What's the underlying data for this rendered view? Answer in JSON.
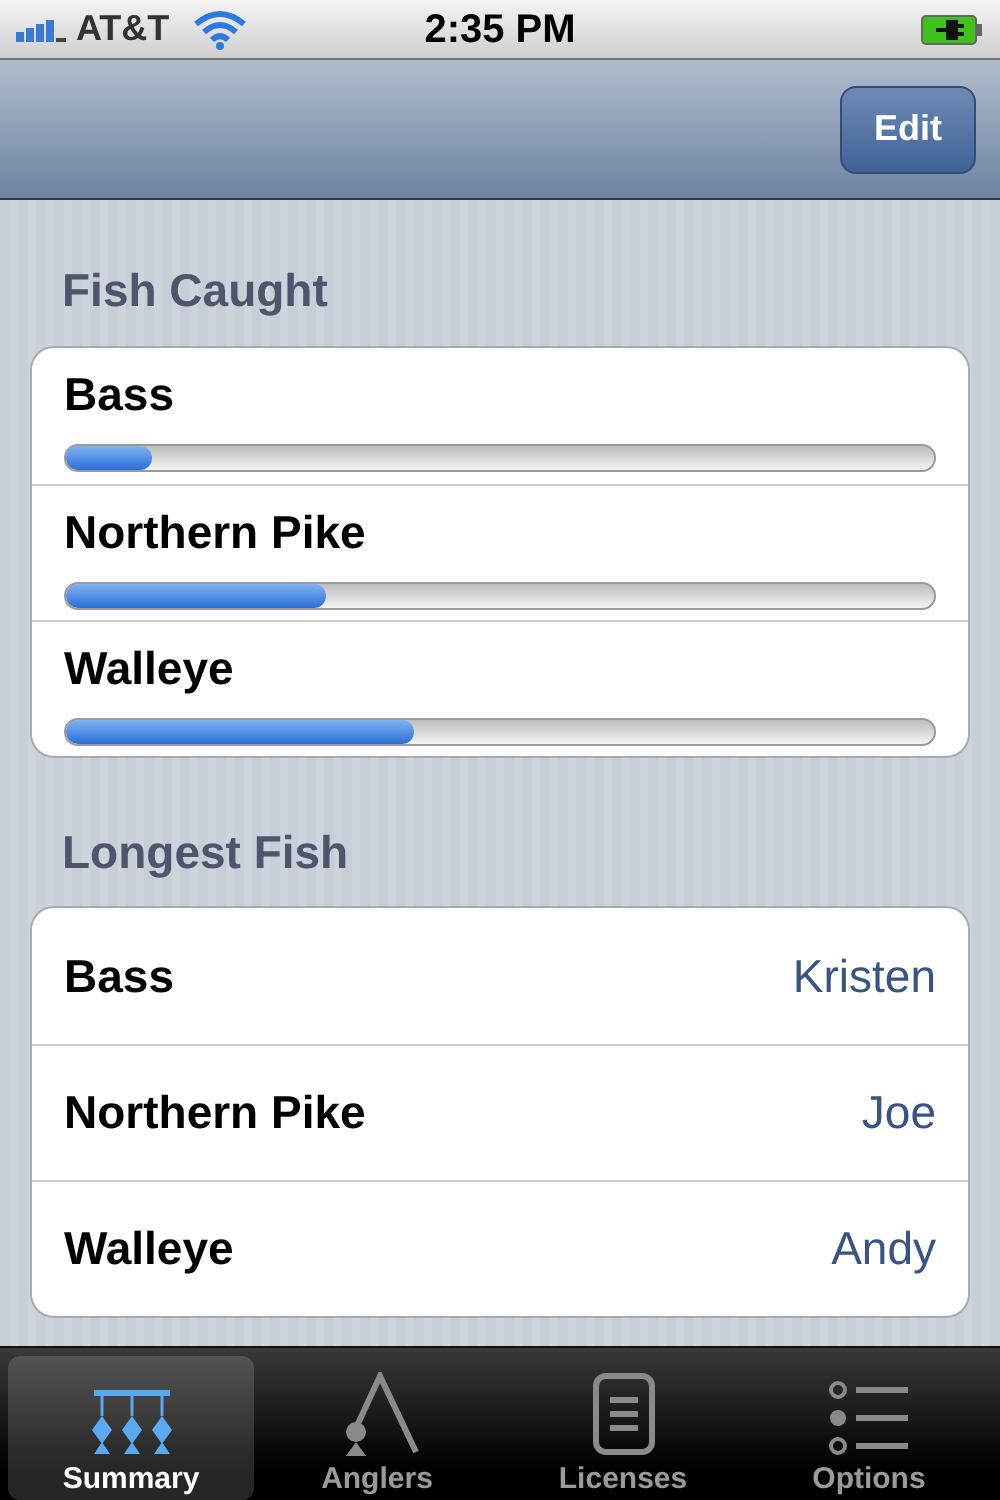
{
  "status_bar": {
    "carrier": "AT&T",
    "time": "2:35 PM"
  },
  "nav_bar": {
    "right_button": "Edit"
  },
  "fish_caught": {
    "title": "Fish Caught",
    "rows": [
      {
        "label": "Bass",
        "level": 0.1
      },
      {
        "label": "Northern Pike",
        "level": 0.3
      },
      {
        "label": "Walleye",
        "level": 0.4
      }
    ]
  },
  "longest_fish": {
    "title": "Longest Fish",
    "rows": [
      {
        "label": "Bass",
        "value": "Kristen"
      },
      {
        "label": "Northern Pike",
        "value": "Joe"
      },
      {
        "label": "Walleye",
        "value": "Andy"
      }
    ]
  },
  "tab_bar": [
    {
      "label": "Summary",
      "kind": "summary",
      "selected": true
    },
    {
      "label": "Anglers",
      "kind": "anglers",
      "selected": false
    },
    {
      "label": "Licenses",
      "kind": "licenses",
      "selected": false
    },
    {
      "label": "Options",
      "kind": "options",
      "selected": false
    }
  ]
}
